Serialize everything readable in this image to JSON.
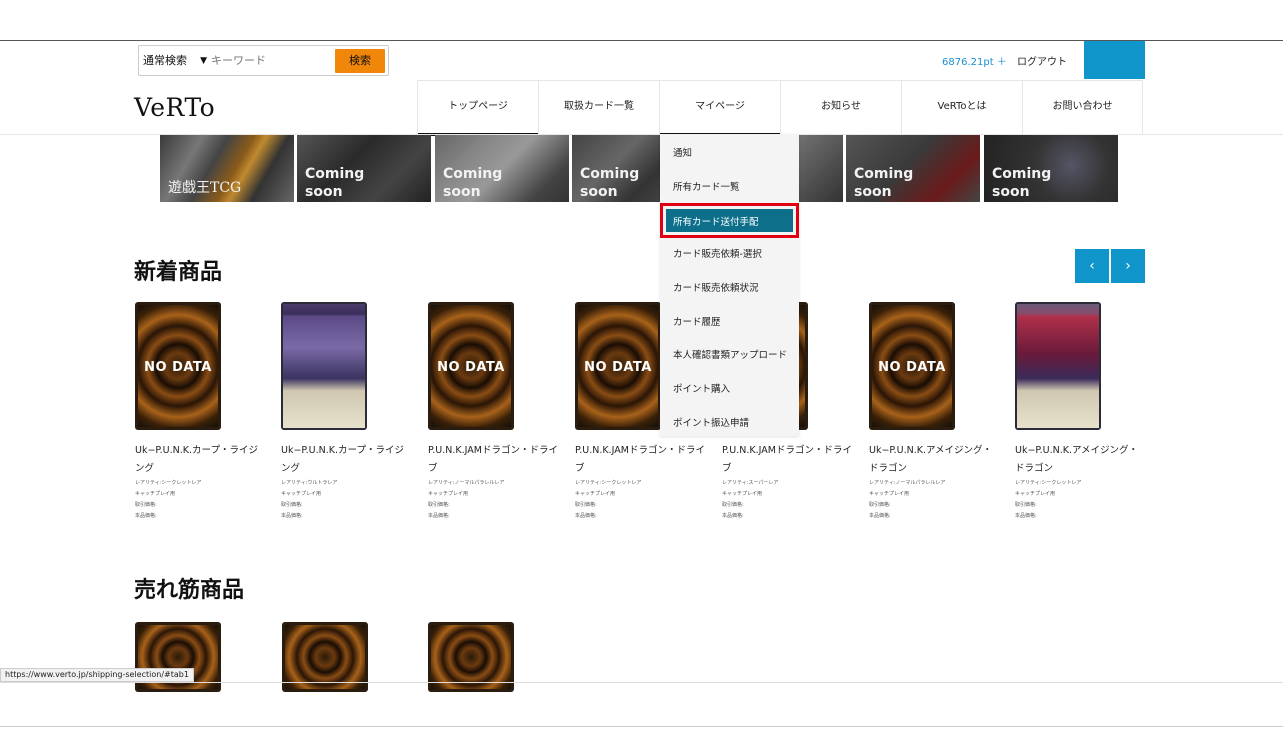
{
  "search": {
    "mode": "通常検索",
    "placeholder": "キーワード",
    "button": "検索"
  },
  "account": {
    "points": "6876.21pt ＋",
    "logout": "ログアウト"
  },
  "logo": "VeRTo",
  "nav": [
    {
      "label": "トップページ"
    },
    {
      "label": "取扱カード一覧"
    },
    {
      "label": "マイページ"
    },
    {
      "label": "お知らせ"
    },
    {
      "label": "VeRToとは"
    },
    {
      "label": "お問い合わせ"
    }
  ],
  "banners": [
    {
      "label": "遊戯王TCG"
    },
    {
      "label": "Coming\nsoon"
    },
    {
      "label": "Coming\nsoon"
    },
    {
      "label": "Coming\nsoon"
    },
    {
      "label": ""
    },
    {
      "label": "Coming\nsoon"
    },
    {
      "label": "Coming\nsoon"
    }
  ],
  "dropdown": [
    "通知",
    "所有カード一覧",
    "所有カード送付手配",
    "カード販売依頼-選択",
    "カード販売依頼状況",
    "カード履歴",
    "本人確認書類アップロード",
    "ポイント購入",
    "ポイント振込申請"
  ],
  "sections": {
    "new": "新着商品",
    "popular": "売れ筋商品"
  },
  "nav_arrows": {
    "prev": "‹",
    "next": "›"
  },
  "no_data": "NO DATA",
  "cards": [
    {
      "name": "Uk−P.U.N.K.カープ・ライジング",
      "meta": [
        "レアリティ:シークレットレア",
        "キャッチプレイ用",
        "取引価格:",
        "本品価格:"
      ],
      "art": "nodata"
    },
    {
      "name": "Uk−P.U.N.K.カープ・ライジング",
      "meta": [
        "レアリティ:ウルトラレア",
        "キャッチプレイ用",
        "取引価格:",
        "本品価格:"
      ],
      "art": "purple"
    },
    {
      "name": "P.U.N.K.JAMドラゴン・ドライブ",
      "meta": [
        "レアリティ:ノーマルパラレルレア",
        "キャッチプレイ用",
        "取引価格:",
        "本品価格:"
      ],
      "art": "nodata"
    },
    {
      "name": "P.U.N.K.JAMドラゴン・ドライブ",
      "meta": [
        "レアリティ:シークレットレア",
        "キャッチプレイ用",
        "取引価格:",
        "本品価格:"
      ],
      "art": "nodata"
    },
    {
      "name": "P.U.N.K.JAMドラゴン・ドライブ",
      "meta": [
        "レアリティ:スーパーレア",
        "キャッチプレイ用",
        "取引価格:",
        "本品価格:"
      ],
      "art": "nodata"
    },
    {
      "name": "Uk−P.U.N.K.アメイジング・ドラゴン",
      "meta": [
        "レアリティ:ノーマルパラレルレア",
        "キャッチプレイ用",
        "取引価格:",
        "本品価格:"
      ],
      "art": "nodata"
    },
    {
      "name": "Uk−P.U.N.K.アメイジング・ドラゴン",
      "meta": [
        "レアリティ:シークレットレア",
        "キャッチプレイ用",
        "取引価格:",
        "本品価格:"
      ],
      "art": "red"
    }
  ],
  "status_url": "https://www.verto.jp/shipping-selection/#tab1"
}
